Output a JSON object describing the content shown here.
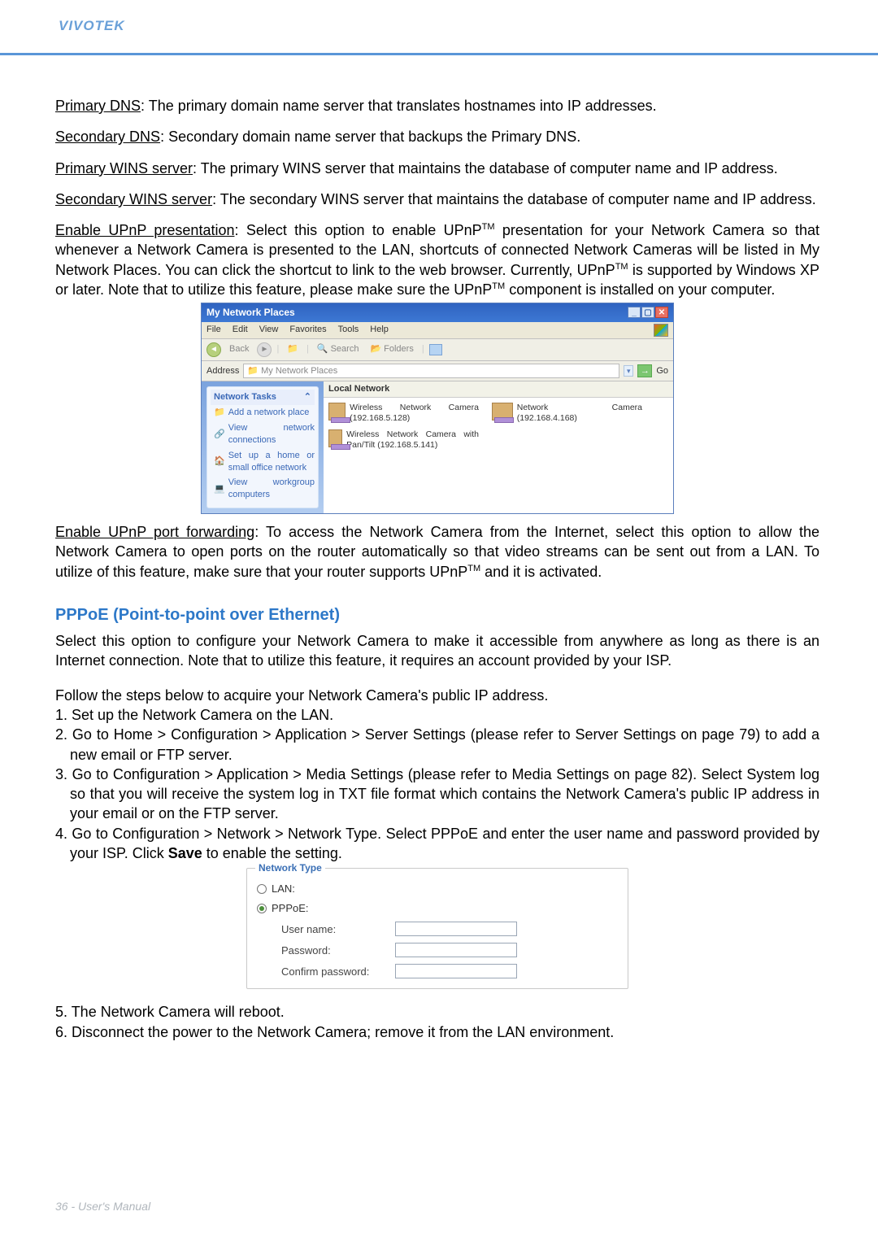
{
  "header": {
    "brand": "VIVOTEK"
  },
  "paras": {
    "primary_dns_label": "Primary DNS",
    "primary_dns_text": ": The primary domain name server that translates hostnames into IP addresses.",
    "secondary_dns_label": "Secondary DNS",
    "secondary_dns_text": ": Secondary domain name server that backups the Primary DNS.",
    "primary_wins_label": "Primary WINS server",
    "primary_wins_text": ": The primary WINS server that maintains the database of computer name and IP address.",
    "secondary_wins_label": "Secondary WINS server",
    "secondary_wins_text": ": The secondary WINS server that maintains the database of computer name and IP address.",
    "upnp_pres_label": "Enable UPnP presentation",
    "upnp_pres_text_a": ": Select this option to enable UPnP",
    "upnp_pres_text_b": " presentation for your Network Camera so that whenever a Network Camera is presented to the LAN, shortcuts of connected Network Cameras will be listed in My Network Places. You can click the shortcut to link to the web browser. Currently, UPnP",
    "upnp_pres_text_c": " is supported by Windows XP or later. Note that to utilize this feature, please make sure the UPnP",
    "upnp_pres_text_d": " component is installed on your computer.",
    "upnp_port_label": "Enable UPnP port forwarding",
    "upnp_port_text_a": ": To access the Network Camera from the Internet, select this option to allow the Network Camera to open ports on the router automatically so that video streams can be sent out from a LAN. To utilize of this feature, make sure that your router supports UPnP",
    "upnp_port_text_b": " and it is activated."
  },
  "pppoe": {
    "title": "PPPoE (Point-to-point over Ethernet)",
    "intro": "Select this option to configure your Network Camera to make it accessible from anywhere as long as there is an Internet connection. Note that to utilize this feature, it requires an account provided by your ISP.",
    "follow": "Follow the steps below to acquire your Network Camera's public IP address.",
    "step1": "1. Set up the Network Camera on the LAN.",
    "step2": "2. Go to Home > Configuration > Application > Server Settings (please refer to Server Settings on page 79) to add a new email or FTP server.",
    "step3": "3. Go to Configuration > Application > Media Settings (please refer to Media Settings on page 82). Select System log so that you will receive the system log in TXT file format which contains the Network Camera's public IP address in your email or on the FTP server.",
    "step4a": "4. Go to Configuration > Network > Network Type. Select PPPoE and enter the user name and password provided by your ISP. Click ",
    "step4b": "Save",
    "step4c": " to enable the setting.",
    "step5": "5. The Network Camera will reboot.",
    "step6": "6. Disconnect the power to the Network Camera; remove it from the LAN environment."
  },
  "window": {
    "title": "My Network Places",
    "menu": [
      "File",
      "Edit",
      "View",
      "Favorites",
      "Tools",
      "Help"
    ],
    "back": "Back",
    "search": "Search",
    "folders": "Folders",
    "addr_label": "Address",
    "addr_value": "My Network Places",
    "go": "Go",
    "tasks_title": "Network Tasks",
    "tasks": [
      "Add a network place",
      "View network connections",
      "Set up a home or small office network",
      "View workgroup computers"
    ],
    "group": "Local Network",
    "items": [
      {
        "name": "Wireless Network Camera (192.168.5.128)"
      },
      {
        "name": "Network Camera (192.168.4.168)"
      },
      {
        "name": "Wireless Network Camera with Pan/Tilt (192.168.5.141)"
      }
    ]
  },
  "network_type": {
    "legend": "Network Type",
    "lan": "LAN:",
    "pppoe": "PPPoE:",
    "user": "User name:",
    "pass": "Password:",
    "confirm": "Confirm password:"
  },
  "footer": "36 - User's Manual",
  "tm": "TM"
}
